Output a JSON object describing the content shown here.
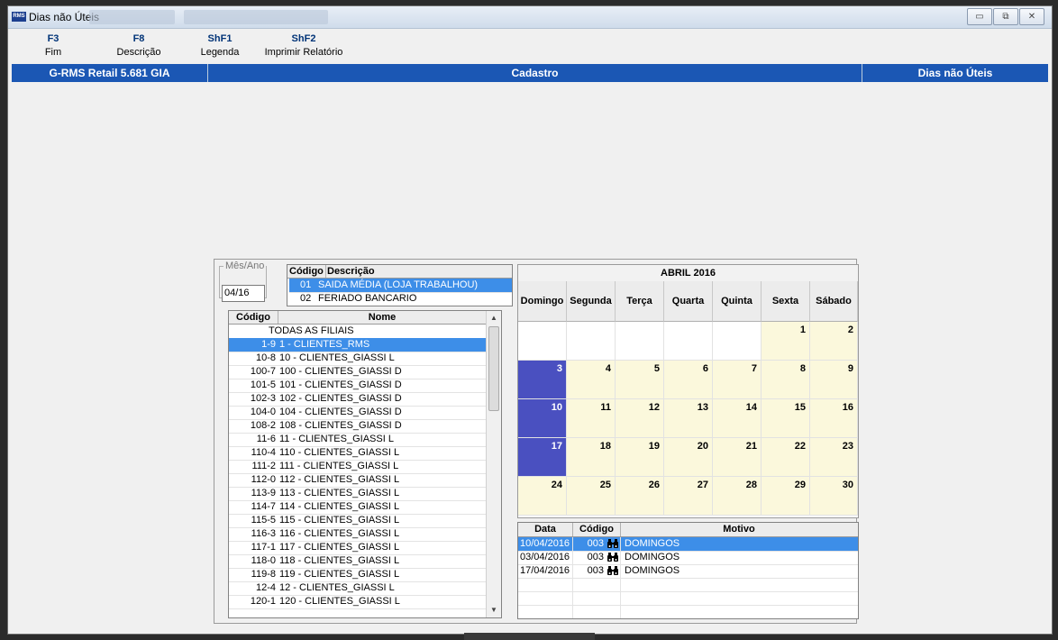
{
  "window": {
    "title": "Dias não Úteis",
    "app_icon_text": "RMS",
    "buttons": [
      "▭",
      "⧉",
      "✕"
    ]
  },
  "function_keys": [
    {
      "key": "F3",
      "label": "Fim"
    },
    {
      "key": "F8",
      "label": "Descrição"
    },
    {
      "key": "ShF1",
      "label": "Legenda"
    },
    {
      "key": "ShF2",
      "label": "Imprimir Relatório"
    }
  ],
  "header_bar": {
    "left": "G-RMS Retail 5.681 GIA",
    "center": "Cadastro",
    "right": "Dias não Úteis"
  },
  "mes_ano": {
    "legend": "Mês/Ano",
    "value": "04/16"
  },
  "descricao_grid": {
    "headers": [
      "Código",
      "Descrição"
    ],
    "rows": [
      {
        "codigo": "01",
        "descricao": "SAIDA MÉDIA (LOJA TRABALHOU)",
        "selected": true
      },
      {
        "codigo": "02",
        "descricao": "FERIADO BANCARIO",
        "selected": false
      }
    ]
  },
  "filiais_grid": {
    "headers": [
      "Código",
      "Nome"
    ],
    "rows": [
      {
        "codigo": "",
        "nome": "TODAS AS FILIAIS"
      },
      {
        "codigo": "1-9",
        "nome": "1 - CLIENTES_RMS",
        "selected": true
      },
      {
        "codigo": "10-8",
        "nome": "10 - CLIENTES_GIASSI L"
      },
      {
        "codigo": "100-7",
        "nome": "100 - CLIENTES_GIASSI D"
      },
      {
        "codigo": "101-5",
        "nome": "101 - CLIENTES_GIASSI D"
      },
      {
        "codigo": "102-3",
        "nome": "102 - CLIENTES_GIASSI D"
      },
      {
        "codigo": "104-0",
        "nome": "104 - CLIENTES_GIASSI D"
      },
      {
        "codigo": "108-2",
        "nome": "108 - CLIENTES_GIASSI D"
      },
      {
        "codigo": "11-6",
        "nome": "11 - CLIENTES_GIASSI L"
      },
      {
        "codigo": "110-4",
        "nome": "110 - CLIENTES_GIASSI L"
      },
      {
        "codigo": "111-2",
        "nome": "111 - CLIENTES_GIASSI L"
      },
      {
        "codigo": "112-0",
        "nome": "112 - CLIENTES_GIASSI L"
      },
      {
        "codigo": "113-9",
        "nome": "113 - CLIENTES_GIASSI L"
      },
      {
        "codigo": "114-7",
        "nome": "114 - CLIENTES_GIASSI L"
      },
      {
        "codigo": "115-5",
        "nome": "115 - CLIENTES_GIASSI L"
      },
      {
        "codigo": "116-3",
        "nome": "116 - CLIENTES_GIASSI L"
      },
      {
        "codigo": "117-1",
        "nome": "117 - CLIENTES_GIASSI L"
      },
      {
        "codigo": "118-0",
        "nome": "118 - CLIENTES_GIASSI L"
      },
      {
        "codigo": "119-8",
        "nome": "119 - CLIENTES_GIASSI L"
      },
      {
        "codigo": "12-4",
        "nome": "12 - CLIENTES_GIASSI L"
      },
      {
        "codigo": "120-1",
        "nome": "120 - CLIENTES_GIASSI L"
      }
    ]
  },
  "calendar": {
    "title": "ABRIL 2016",
    "weekdays": [
      "Domingo",
      "Segunda",
      "Terça",
      "Quarta",
      "Quinta",
      "Sexta",
      "Sábado"
    ],
    "weeks": [
      [
        "",
        "",
        "",
        "",
        "",
        "1",
        "2"
      ],
      [
        "3",
        "4",
        "5",
        "6",
        "7",
        "8",
        "9"
      ],
      [
        "10",
        "11",
        "12",
        "13",
        "14",
        "15",
        "16"
      ],
      [
        "17",
        "18",
        "19",
        "20",
        "21",
        "22",
        "23"
      ],
      [
        "24",
        "25",
        "26",
        "27",
        "28",
        "29",
        "30"
      ]
    ],
    "marked_days": [
      "3",
      "10",
      "17"
    ],
    "colors": {
      "marked": "#4a50c0",
      "workday": "#fbf8dc",
      "selection": "#3d8ee8",
      "header_bar": "#1b57b4"
    }
  },
  "motivo_grid": {
    "headers": [
      "Data",
      "Código",
      "Motivo"
    ],
    "rows": [
      {
        "data": "10/04/2016",
        "codigo": "003",
        "motivo": "DOMINGOS",
        "selected": true
      },
      {
        "data": "03/04/2016",
        "codigo": "003",
        "motivo": "DOMINGOS",
        "selected": false
      },
      {
        "data": "17/04/2016",
        "codigo": "003",
        "motivo": "DOMINGOS",
        "selected": false
      }
    ],
    "row_icon": "binoculars-icon"
  }
}
